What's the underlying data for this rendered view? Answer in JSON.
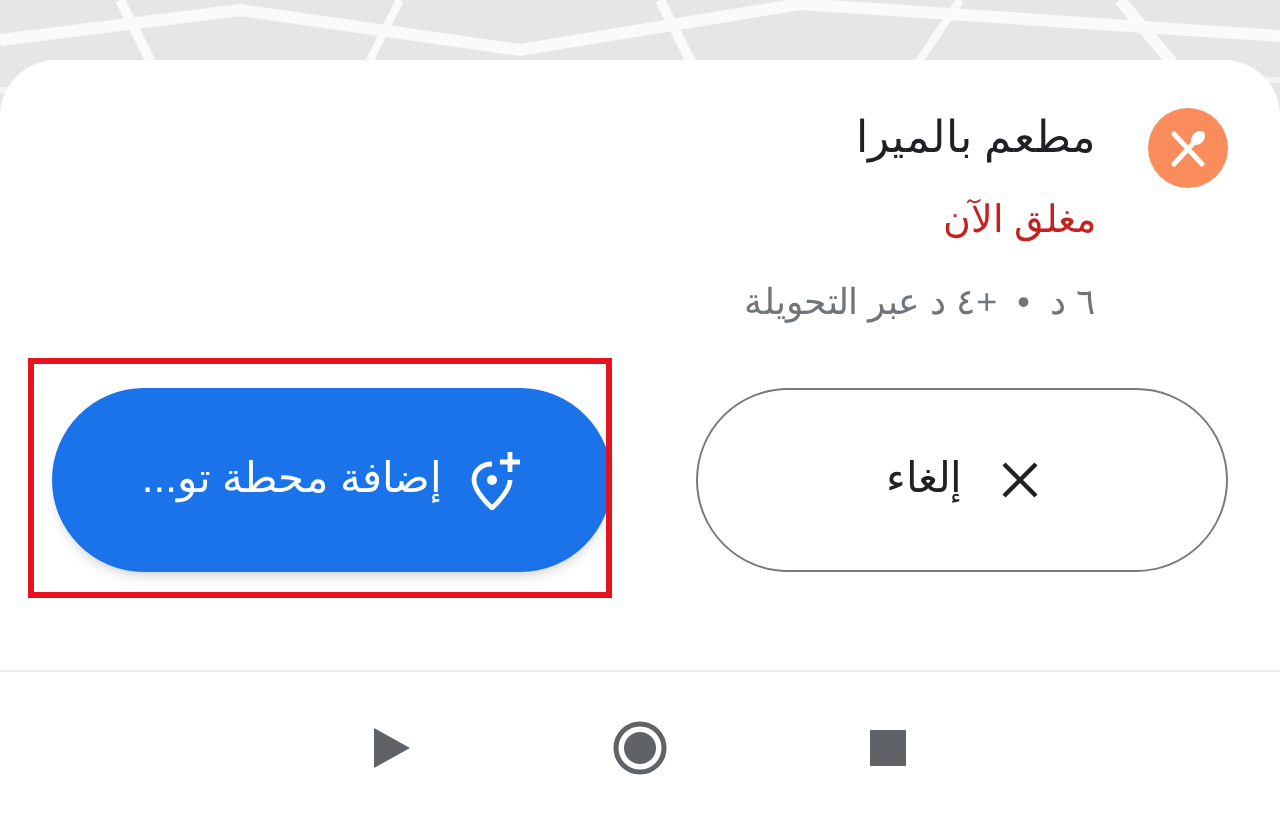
{
  "place": {
    "name": "مطعم بالميرا",
    "status": "مغلق الآن",
    "detour": "٦ د  •  +٤ د عبر التحويلة"
  },
  "buttons": [
    {
      "kind": "outline",
      "label": "إلغاء",
      "highlighted": false
    },
    {
      "kind": "primary",
      "label": "إضافة محطة تو...",
      "highlighted": true
    }
  ],
  "nav_bar": [
    {
      "kind": "back"
    },
    {
      "kind": "home"
    },
    {
      "kind": "recents"
    }
  ]
}
